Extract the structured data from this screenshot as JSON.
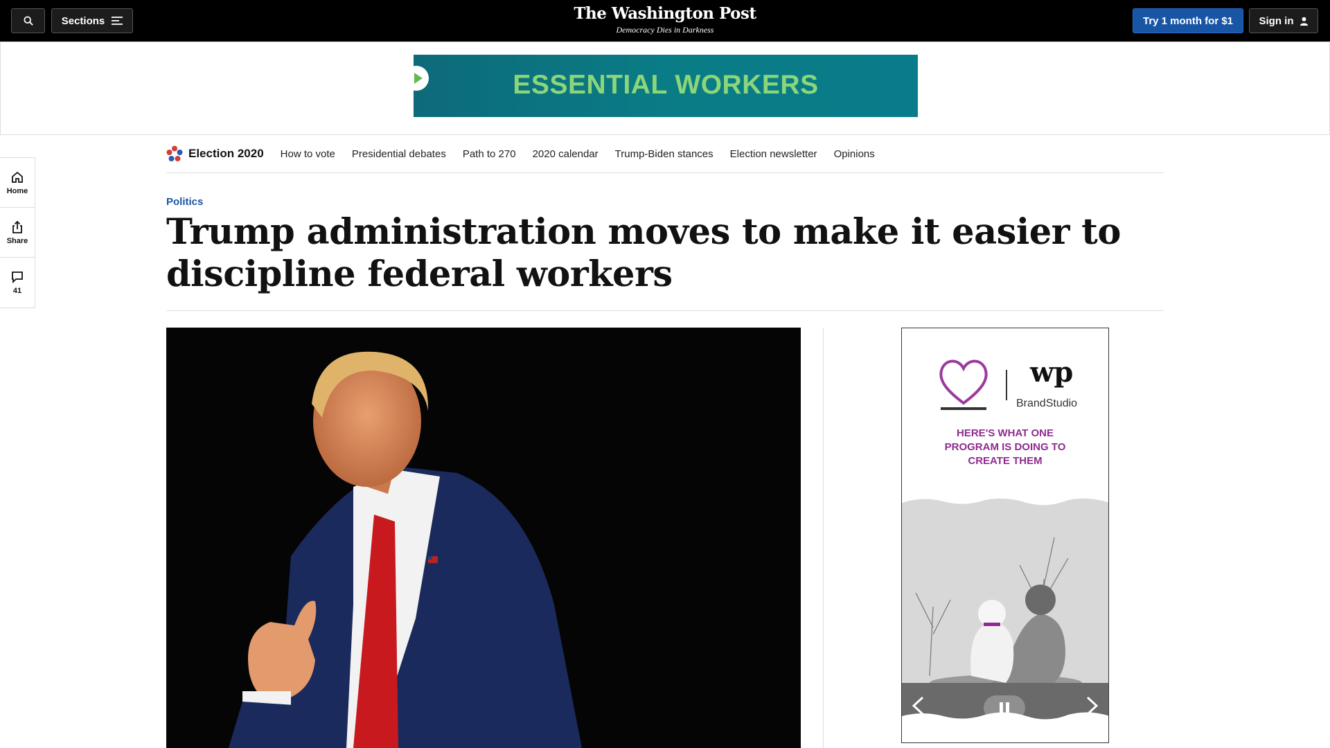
{
  "topbar": {
    "sections_label": "Sections",
    "logo": "The Washington Post",
    "tagline": "Democracy Dies in Darkness",
    "try_label": "Try 1 month for $1",
    "signin_label": "Sign in"
  },
  "ad_banner": {
    "text": "ESSENTIAL WORKERS"
  },
  "siderail": {
    "home": "Home",
    "share": "Share",
    "comments": "41"
  },
  "election_nav": {
    "brand": "Election 2020",
    "links": [
      "How to vote",
      "Presidential debates",
      "Path to 270",
      "2020 calendar",
      "Trump-Biden stances",
      "Election newsletter",
      "Opinions"
    ]
  },
  "article": {
    "kicker": "Politics",
    "headline": "Trump administration moves to make it easier to discipline federal workers"
  },
  "side_ad": {
    "brand_sub": "BrandStudio",
    "wp_mark": "wp",
    "headline": "HERE'S WHAT ONE PROGRAM IS DOING TO CREATE THEM"
  },
  "colors": {
    "accent_blue": "#1955a5",
    "ad_teal": "#0a7c86",
    "ad_green_text": "#8cd67a",
    "ad_purple": "#8e2b8f"
  }
}
